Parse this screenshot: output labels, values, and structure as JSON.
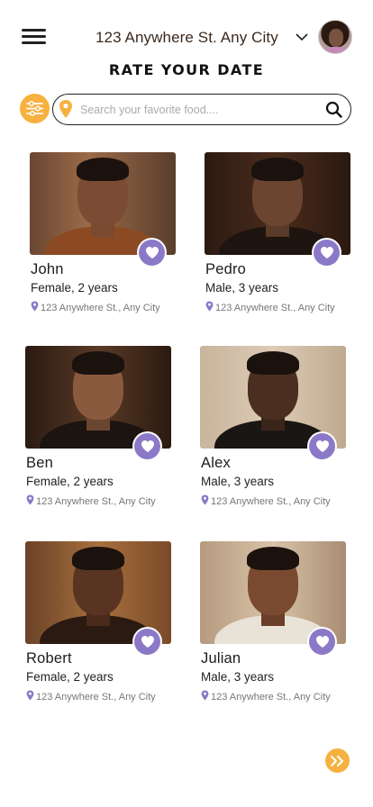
{
  "header": {
    "location": "123 Anywhere St. Any City",
    "title": "RATE YOUR DATE"
  },
  "search": {
    "placeholder": "Search your favorite food....",
    "value": ""
  },
  "colors": {
    "accent_orange": "#f6b140",
    "heart_purple": "#8b79c8"
  },
  "icons": {
    "menu": "hamburger-icon",
    "dropdown": "chevron-down-icon",
    "filter": "sliders-icon",
    "pin": "map-pin-icon",
    "search": "search-icon",
    "favorite": "heart-icon",
    "next": "double-chevron-right-icon"
  },
  "profiles": [
    {
      "name": "John",
      "details": "Female, 2 years",
      "address": "123 Anywhere St., Any City"
    },
    {
      "name": "Pedro",
      "details": "Male, 3 years",
      "address": "123 Anywhere St., Any City"
    },
    {
      "name": "Ben",
      "details": "Female, 2 years",
      "address": "123 Anywhere St., Any City"
    },
    {
      "name": "Alex",
      "details": "Male, 3 years",
      "address": "123 Anywhere St., Any City"
    },
    {
      "name": "Robert",
      "details": "Female, 2 years",
      "address": "123 Anywhere St., Any City"
    },
    {
      "name": "Julian",
      "details": "Male, 3 years",
      "address": "123 Anywhere St., Any City"
    }
  ]
}
